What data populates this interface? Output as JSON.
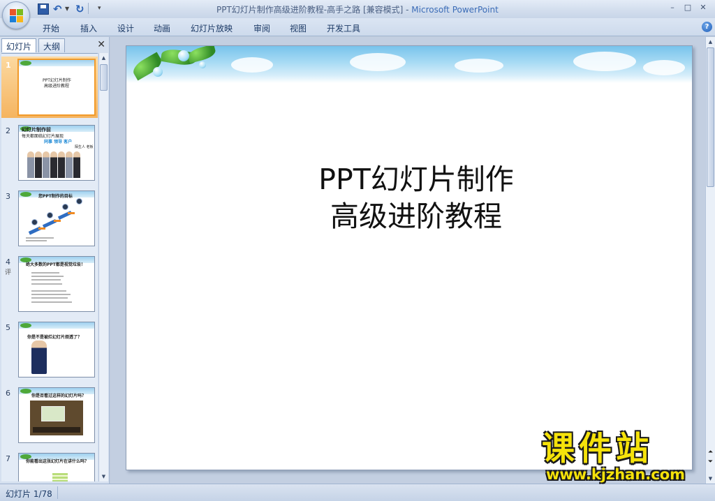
{
  "window": {
    "title": "PPT幻灯片制作高级进阶教程-高手之路 [兼容模式]",
    "separator": " - ",
    "app_name": "Microsoft PowerPoint",
    "min_glyph": "–",
    "max_glyph": "□",
    "close_glyph": "✕"
  },
  "quick_access": {
    "undo_glyph": "↶",
    "redo_glyph": "↻",
    "dropdown_glyph": "▼",
    "customize_glyph": "▾"
  },
  "ribbon": {
    "tabs": [
      "开始",
      "插入",
      "设计",
      "动画",
      "幻灯片放映",
      "审阅",
      "视图",
      "开发工具"
    ],
    "help_glyph": "?"
  },
  "left_panel": {
    "tabs": [
      "幻灯片",
      "大纲"
    ],
    "close_glyph": "✕",
    "thumbnails": [
      {
        "num": "1",
        "lines": [
          "PPT幻灯片制作",
          "高级进阶教程"
        ]
      },
      {
        "num": "2",
        "lines": [
          "幻灯片制作前",
          "每天都面临幻灯片展现",
          "同事 领导 客户",
          "陌生人 老板"
        ]
      },
      {
        "num": "3",
        "lines": [
          "您PPT制作的目标"
        ]
      },
      {
        "num": "4",
        "lines": [
          "绝大多数的PPT都是",
          "视觉垃圾！"
        ],
        "note": "评"
      },
      {
        "num": "5",
        "lines": [
          "你是不是被烂幻灯片烦透了？"
        ]
      },
      {
        "num": "6",
        "lines": [
          "你是否看过这样的幻灯片吗？"
        ]
      },
      {
        "num": "7",
        "lines": [
          "你能看出这张幻灯片在讲什么吗？"
        ]
      }
    ]
  },
  "slide": {
    "title_line1": "PPT幻灯片制作",
    "title_line2": "高级进阶教程"
  },
  "status": {
    "slide_counter": "幻灯片 1/78"
  },
  "watermark": {
    "name": "课件站",
    "url": "www.kjzhan.com"
  },
  "colors": {
    "accent": "#f5b460",
    "title_app": "#3b6cb7",
    "watermark": "#f5e20a"
  }
}
